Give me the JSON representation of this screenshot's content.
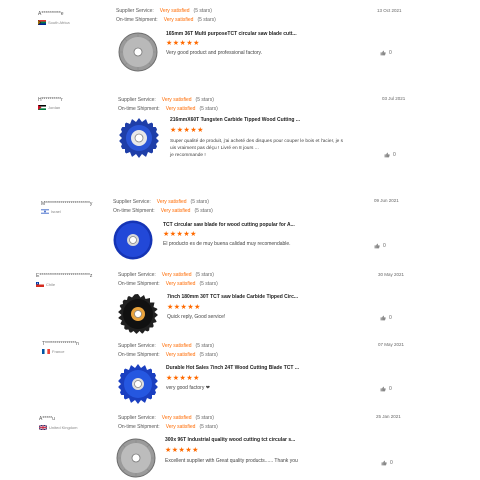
{
  "reviews": [
    {
      "buyer": "A**********e",
      "country": "South Africa",
      "supplier_label": "Supplier Service:",
      "supplier_value": "Very satisfied",
      "supplier_stars": "(5 stars)",
      "shipment_label": "On-time Shipment:",
      "shipment_value": "Very satisfied",
      "shipment_stars": "(5 stars)",
      "date": "13 Oct 2021",
      "product": "165mm 36T Multi purposeTCT circular saw blade cutt...",
      "stars": "★★★★★",
      "comment": "Very good product and professional factory.",
      "helpful": "0",
      "disc": "diamond"
    },
    {
      "buyer": "H**********r",
      "country": "Jordan",
      "supplier_label": "Supplier Service:",
      "supplier_value": "Very satisfied",
      "supplier_stars": "(5 stars)",
      "shipment_label": "On-time Shipment:",
      "shipment_value": "Very satisfied",
      "shipment_stars": "(5 stars)",
      "date": "03 Jul 2021",
      "product": "216mmX60T Tungsten Carbide Tipped Wood Cutting ...",
      "stars": "★★★★★",
      "comment": "Super qualité de produit, j'ai acheté des disques pour couper le bois et l'acier, je s\nuis vraiment pas déçu ! Livré en 8 jours ...\nje recommande !",
      "helpful": "0",
      "disc": "blue-teeth"
    },
    {
      "buyer": "M***********************y",
      "country": "Israel",
      "supplier_label": "Supplier Service:",
      "supplier_value": "Very satisfied",
      "supplier_stars": "(5 stars)",
      "shipment_label": "On-time Shipment:",
      "shipment_value": "Very satisfied",
      "shipment_stars": "(5 stars)",
      "date": "09 Jun 2021",
      "product": "TCT circular saw blade for wood cutting popular for A...",
      "stars": "★★★★★",
      "comment": "El producto es de muy buena calidad muy recomendable.",
      "helpful": "0",
      "disc": "blue-plain"
    },
    {
      "buyer": "E**************************z",
      "country": "Chile",
      "supplier_label": "Supplier Service:",
      "supplier_value": "Very satisfied",
      "supplier_stars": "(5 stars)",
      "shipment_label": "On-time Shipment:",
      "shipment_value": "Very satisfied",
      "shipment_stars": "(5 stars)",
      "date": "30 May 2021",
      "product": "7inch 180mm 30T TCT saw blade Carbide Tipped Circ...",
      "stars": "★★★★★",
      "comment": "Quick reply, Good service!",
      "helpful": "0",
      "disc": "black-teeth"
    },
    {
      "buyer": "T****************n",
      "country": "France",
      "supplier_label": "Supplier Service:",
      "supplier_value": "Very satisfied",
      "supplier_stars": "(5 stars)",
      "shipment_label": "On-time Shipment:",
      "shipment_value": "Very satisfied",
      "shipment_stars": "(5 stars)",
      "date": "07 May 2021",
      "product": "Durable Hot Sales 7inch 24T Wood Cutting Blade TCT ...",
      "stars": "★★★★★",
      "comment": "very good factory ❤",
      "helpful": "0",
      "disc": "blue-teeth"
    },
    {
      "buyer": "A*****u",
      "country": "United Kingdom",
      "supplier_label": "Supplier Service:",
      "supplier_value": "Very satisfied",
      "supplier_stars": "(5 stars)",
      "shipment_label": "On-time Shipment:",
      "shipment_value": "Very satisfied",
      "shipment_stars": "(5 stars)",
      "date": "25 Jan 2021",
      "product": "300x 96T Industrial quality wood cutting tct circular s...",
      "stars": "★★★★★",
      "comment": "Excellent supplier with Great quality products...... Thank you",
      "helpful": "0",
      "disc": "diamond"
    }
  ],
  "colors": {
    "accent": "#ff6a00"
  }
}
